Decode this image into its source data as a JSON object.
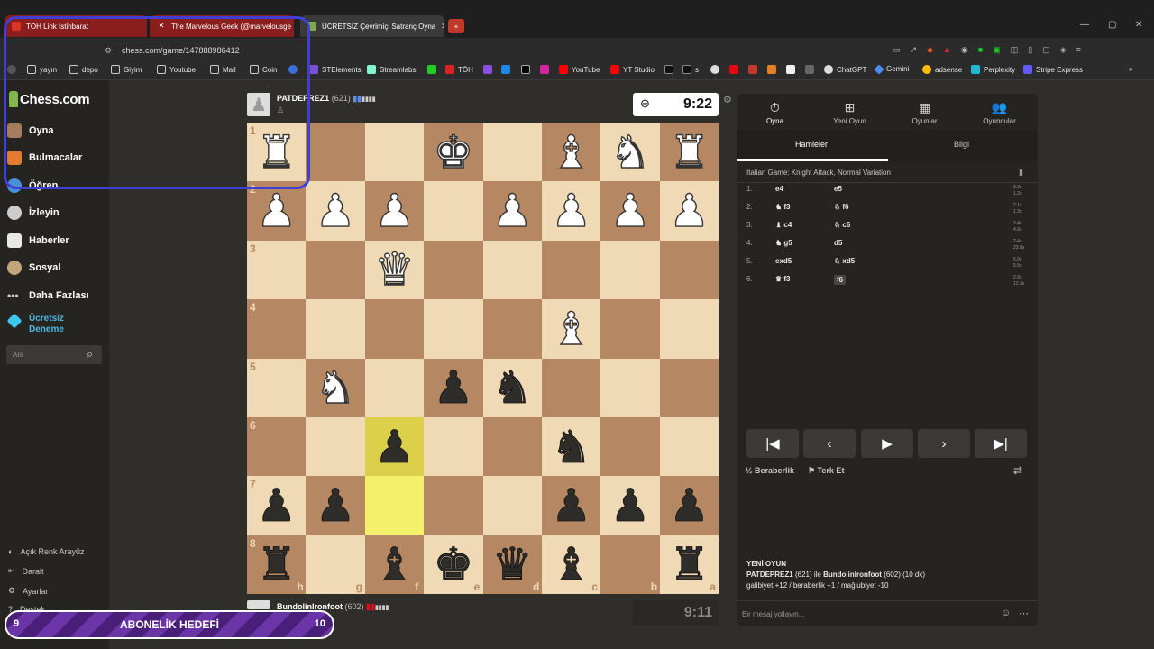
{
  "browser": {
    "tabs": [
      {
        "title": "TÖH Link İstihbarat",
        "active": false
      },
      {
        "title": "The Marvelous Geek (@marvelousge",
        "active": false
      },
      {
        "title": "ÜCRETSİZ Çevrimiçi Satranç Oyna",
        "active": true
      }
    ],
    "url": "chess.com/game/147888986412",
    "bookmarks": [
      "yayın",
      "depo",
      "Giyim",
      "Youtube",
      "Mail",
      "Coin",
      "STElements",
      "Streamlabs",
      "TÖH",
      "YouTube",
      "YT Studio",
      "s",
      "ChatGPT",
      "Gemini",
      "adsense",
      "Perplexity",
      "Stripe Express"
    ]
  },
  "sidebar": {
    "logo": "Chess.com",
    "items": [
      "Oyna",
      "Bulmacalar",
      "Öğren",
      "İzleyin",
      "Haberler",
      "Sosyal",
      "Daha Fazlası"
    ],
    "trial": "Ücretsiz Deneme",
    "search_placeholder": "Ara",
    "bottom": [
      "Açık Renk Arayüz",
      "Daralt",
      "Ayarlar",
      "Destek"
    ]
  },
  "top_player": {
    "name": "PATDEPREZ1",
    "rating": "(621)",
    "clock": "9:22"
  },
  "bottom_player": {
    "name": "BundolinIronfoot",
    "rating": "(602)",
    "clock": "9:11"
  },
  "board": {
    "ranks": [
      "1",
      "2",
      "3",
      "4",
      "5",
      "6",
      "7",
      "8"
    ],
    "files": [
      "h",
      "g",
      "f",
      "e",
      "d",
      "c",
      "b",
      "a"
    ],
    "highlight": [
      "f6",
      "f7"
    ],
    "pieces": [
      {
        "sq": "h1",
        "p": "wR"
      },
      {
        "sq": "e1",
        "p": "wK"
      },
      {
        "sq": "c1",
        "p": "wB"
      },
      {
        "sq": "b1",
        "p": "wN"
      },
      {
        "sq": "a1",
        "p": "wR"
      },
      {
        "sq": "h2",
        "p": "wP"
      },
      {
        "sq": "g2",
        "p": "wP"
      },
      {
        "sq": "f2",
        "p": "wP"
      },
      {
        "sq": "d2",
        "p": "wP"
      },
      {
        "sq": "c2",
        "p": "wP"
      },
      {
        "sq": "b2",
        "p": "wP"
      },
      {
        "sq": "a2",
        "p": "wP"
      },
      {
        "sq": "f3",
        "p": "wQ"
      },
      {
        "sq": "c4",
        "p": "wB"
      },
      {
        "sq": "g5",
        "p": "wN"
      },
      {
        "sq": "e5",
        "p": "bP"
      },
      {
        "sq": "d5",
        "p": "bN"
      },
      {
        "sq": "f6",
        "p": "bP"
      },
      {
        "sq": "c6",
        "p": "bN"
      },
      {
        "sq": "h7",
        "p": "bP"
      },
      {
        "sq": "g7",
        "p": "bP"
      },
      {
        "sq": "c7",
        "p": "bP"
      },
      {
        "sq": "b7",
        "p": "bP"
      },
      {
        "sq": "a7",
        "p": "bP"
      },
      {
        "sq": "h8",
        "p": "bR"
      },
      {
        "sq": "f8",
        "p": "bB"
      },
      {
        "sq": "e8",
        "p": "bK"
      },
      {
        "sq": "d8",
        "p": "bQ"
      },
      {
        "sq": "c8",
        "p": "bB"
      },
      {
        "sq": "a8",
        "p": "bR"
      }
    ]
  },
  "panel": {
    "tabs": [
      {
        "label": "Oyna",
        "icon": "⏱"
      },
      {
        "label": "Yeni Oyun",
        "icon": "⊞"
      },
      {
        "label": "Oyunlar",
        "icon": "▦"
      },
      {
        "label": "Oyuncular",
        "icon": "👥"
      }
    ],
    "subtabs": [
      "Hamleler",
      "Bilgi"
    ],
    "opening": "Italian Game: Knight Attack, Normal Variation",
    "moves": [
      {
        "n": "1.",
        "w": "e4",
        "b": "e5",
        "tw": "3.2s",
        "tb": "1.2s"
      },
      {
        "n": "2.",
        "w": "♞ f3",
        "b": "♘ f6",
        "tw": "2.1s",
        "tb": "1.3s"
      },
      {
        "n": "3.",
        "w": "♝ c4",
        "b": "♘ c6",
        "tw": "3.4s",
        "tb": "4.9s"
      },
      {
        "n": "4.",
        "w": "♞ g5",
        "b": "d5",
        "tw": "2.4s",
        "tb": "23.0s"
      },
      {
        "n": "5.",
        "w": "exd5",
        "b": "♘ xd5",
        "tw": "5.0s",
        "tb": "5.5s"
      },
      {
        "n": "6.",
        "w": "♛ f3",
        "b": "f6",
        "tw": "2.9s",
        "tb": "12.3s"
      }
    ],
    "draw": "Beraberlik",
    "resign": "Terk Et",
    "new_game_title": "YENİ OYUN",
    "new_game_p1": "PATDEPREZ1",
    "new_game_p1r": "(621) ile",
    "new_game_p2": "BundolinIronfoot",
    "new_game_p2r": "(602) (10 dk)",
    "new_game_stats": "galibiyet +12 / beraberlik +1 / mağlubiyet -10",
    "chat_placeholder": "Bir mesaj yollayın..."
  },
  "goal": {
    "left": "9",
    "label": "ABONELİK HEDEFİ",
    "right": "10"
  }
}
